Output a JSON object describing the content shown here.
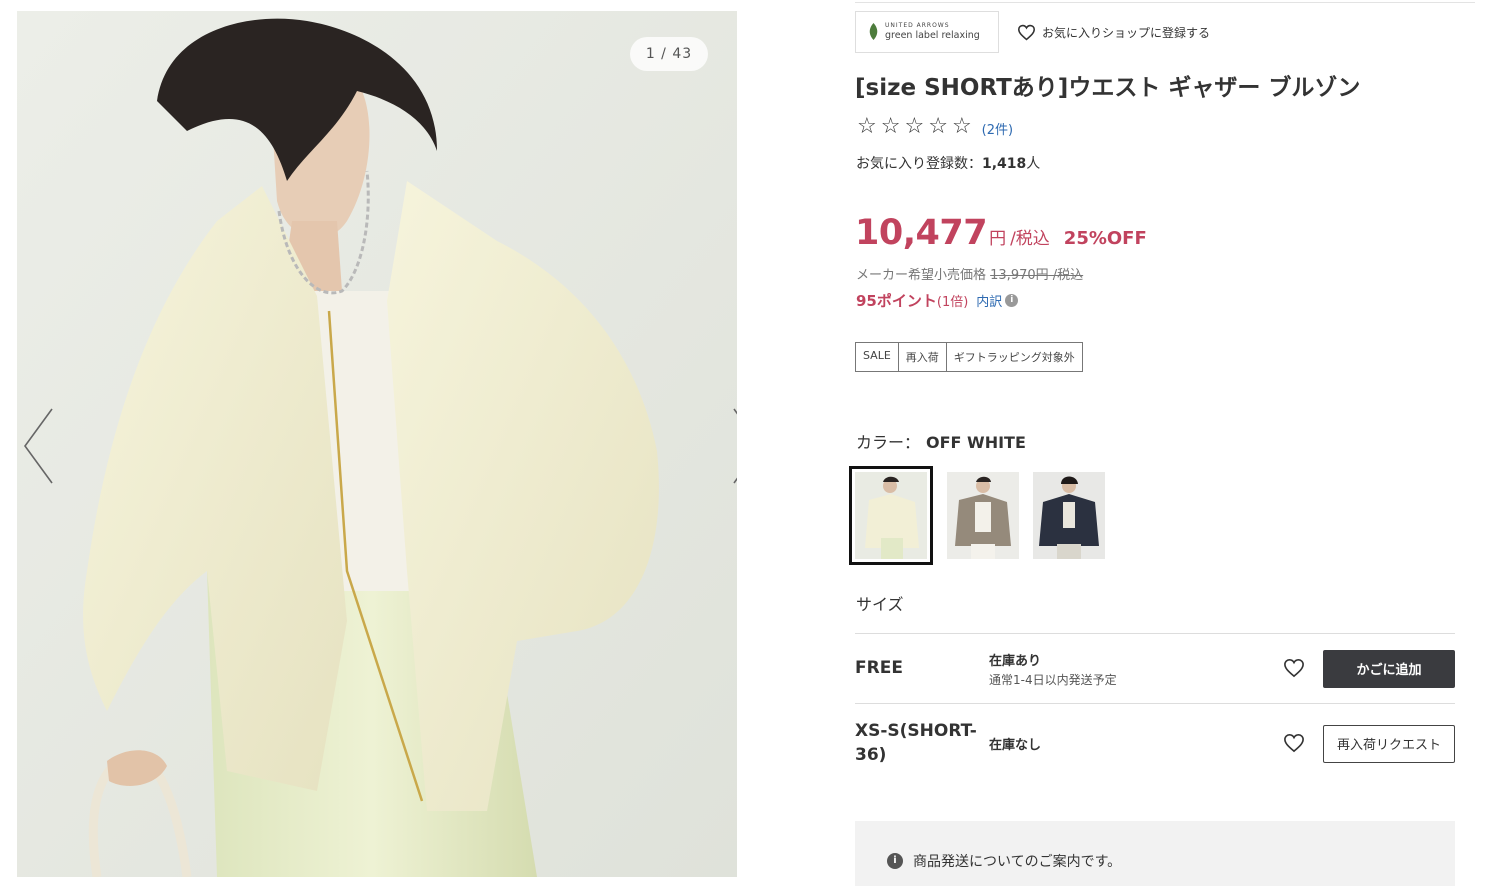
{
  "gallery": {
    "counter": "1 / 43",
    "prev_icon": "chevron-left-icon",
    "next_icon": "chevron-right-icon"
  },
  "shop": {
    "logo_line1": "UNITED ARROWS",
    "logo_line2": "green label relaxing",
    "favorite_shop_label": "お気に入りショップに登録する",
    "favorite_icon": "heart-outline-icon"
  },
  "product": {
    "title": "[size SHORTあり]ウエスト ギャザー ブルゾン",
    "rating_stars": 0,
    "rating_max": 5,
    "review_count": "(2件)",
    "favorites_label": "お気に入り登録数：",
    "favorites_count": "1,418",
    "favorites_unit": "人"
  },
  "price": {
    "amount": "10,477",
    "unit": "円",
    "tax": "/税込",
    "discount": "25%OFF",
    "msrp_label": "メーカー希望小売価格 ",
    "msrp_value": "13,970円",
    "msrp_tax": " /税込",
    "points": "95ポイント",
    "points_multiplier": "(1倍)",
    "breakdown_label": "内訳",
    "breakdown_icon": "info-icon"
  },
  "tags": [
    "SALE",
    "再入荷",
    "ギフトラッピング対象外"
  ],
  "color": {
    "label": "カラー：",
    "selected": "OFF WHITE",
    "swatches": [
      {
        "name": "OFF WHITE",
        "color": "#ece8cf",
        "selected": true
      },
      {
        "name": "BEIGE",
        "color": "#9a8f80",
        "selected": false
      },
      {
        "name": "NAVY",
        "color": "#2d3340",
        "selected": false
      }
    ]
  },
  "size": {
    "label": "サイズ",
    "rows": [
      {
        "name": "FREE",
        "stock": "在庫あり",
        "shipping": "通常1-4日以内発送予定",
        "action": "かごに追加"
      },
      {
        "name": "XS-S(SHORT-36)",
        "stock": "在庫なし",
        "shipping": "",
        "action": "再入荷リクエスト"
      }
    ]
  },
  "notice": {
    "title": "商品発送についてのご案内です。",
    "icon": "info-icon"
  },
  "colors": {
    "price_red": "#c1435e",
    "link_blue": "#2e6ab1",
    "cart_button": "#3a3b3f"
  }
}
